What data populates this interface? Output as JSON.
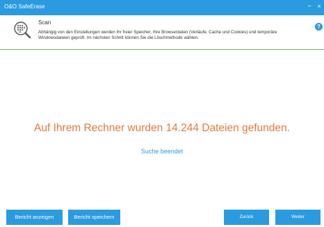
{
  "window": {
    "title": "O&O SafeErase",
    "minimize_glyph": "–",
    "close_glyph": "×"
  },
  "header": {
    "step_title": "Scan",
    "description": "Abhängig von den Einstellungen werden Ihr freier Speicher, Ihre Browserdaten (Verläufe, Cache und Cookies) und temporäre Windowsdateien geprüft. Im nächsten Schritt können Sie die Löschmethode wählen.",
    "help_label": "?",
    "icon": "scan-icon"
  },
  "main": {
    "result_text": "Auf Ihrem Rechner wurden 14.244 Dateien gefunden.",
    "status_text": "Suche beendet"
  },
  "buttons": {
    "show_report": "Bericht anzeigen",
    "save_report": "Bericht speichern",
    "back": "Zurück",
    "next": "Weiter"
  },
  "colors": {
    "accent": "#2b9be0",
    "result": "#e27a3f",
    "separator": "#5cb85c"
  }
}
